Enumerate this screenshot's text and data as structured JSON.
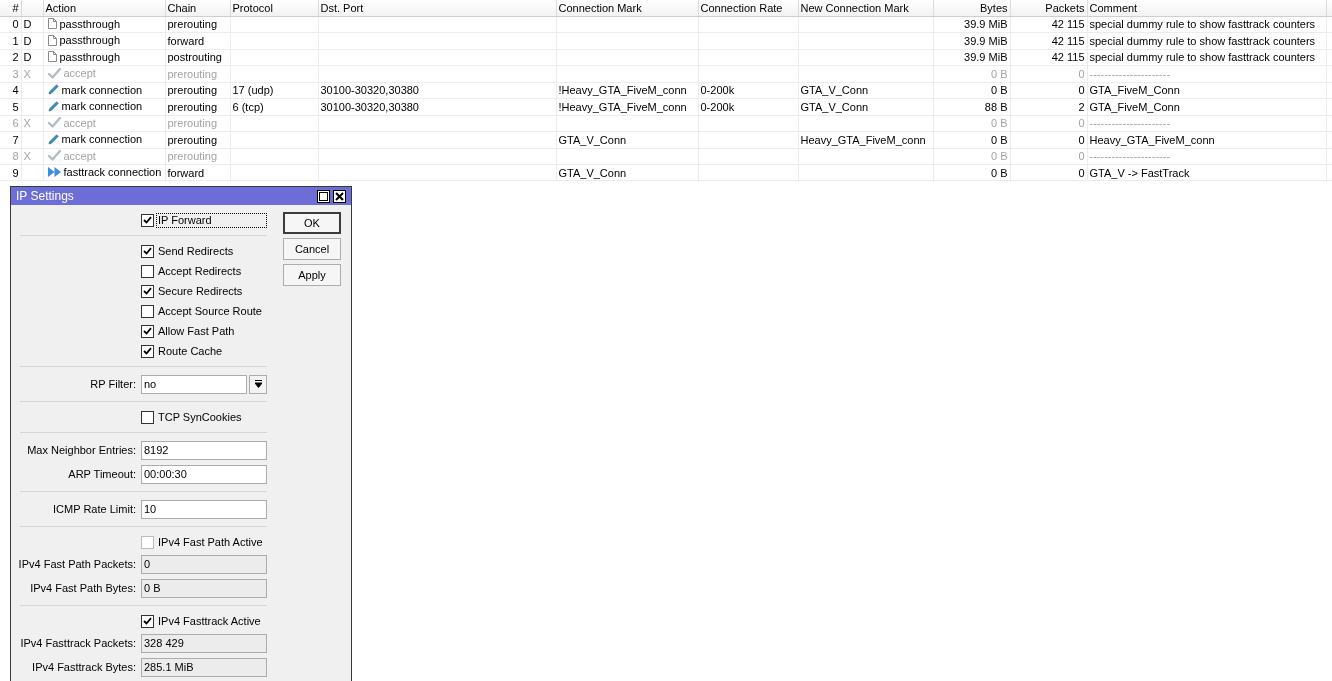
{
  "table": {
    "columns": [
      "#",
      "Action",
      "Chain",
      "Protocol",
      "Dst. Port",
      "Connection Mark",
      "Connection Rate",
      "New Connection Mark",
      "Bytes",
      "Packets",
      "Comment"
    ],
    "rows": [
      {
        "number": "0",
        "flag": "D",
        "kind": "passthrough",
        "action": "passthrough",
        "chain": "prerouting",
        "bytes": "39.9 MiB",
        "packets": "42 115",
        "comment": "special dummy rule to show fasttrack counters",
        "disabled": false
      },
      {
        "number": "1",
        "flag": "D",
        "kind": "passthrough",
        "action": "passthrough",
        "chain": "forward",
        "bytes": "39.9 MiB",
        "packets": "42 115",
        "comment": "special dummy rule to show fasttrack counters",
        "disabled": false
      },
      {
        "number": "2",
        "flag": "D",
        "kind": "passthrough",
        "action": "passthrough",
        "chain": "postrouting",
        "bytes": "39.9 MiB",
        "packets": "42 115",
        "comment": "special dummy rule to show fasttrack counters",
        "disabled": false
      },
      {
        "number": "3",
        "flag": "X",
        "kind": "accept",
        "action": "accept",
        "chain": "prerouting",
        "bytes": "0 B",
        "packets": "0",
        "comment": "----------------------",
        "disabled": true
      },
      {
        "number": "4",
        "kind": "mark",
        "action": "mark connection",
        "chain": "prerouting",
        "protocol": "17 (udp)",
        "dst_port": "30100-30320,30380",
        "connection_mark": "!Heavy_GTA_FiveM_conn",
        "connection_rate": "0-200k",
        "new_connection_mark": "GTA_V_Conn",
        "bytes": "0 B",
        "packets": "0",
        "comment": "GTA_FiveM_Conn",
        "disabled": false
      },
      {
        "number": "5",
        "kind": "mark",
        "action": "mark connection",
        "chain": "prerouting",
        "protocol": "6 (tcp)",
        "dst_port": "30100-30320,30380",
        "connection_mark": "!Heavy_GTA_FiveM_conn",
        "connection_rate": "0-200k",
        "new_connection_mark": "GTA_V_Conn",
        "bytes": "88 B",
        "packets": "2",
        "comment": "GTA_FiveM_Conn",
        "disabled": false
      },
      {
        "number": "6",
        "flag": "X",
        "kind": "accept",
        "action": "accept",
        "chain": "prerouting",
        "bytes": "0 B",
        "packets": "0",
        "comment": "----------------------",
        "disabled": true
      },
      {
        "number": "7",
        "kind": "mark",
        "action": "mark connection",
        "chain": "prerouting",
        "connection_mark": "GTA_V_Conn",
        "new_connection_mark": "Heavy_GTA_FiveM_conn",
        "bytes": "0 B",
        "packets": "0",
        "comment": "Heavy_GTA_FiveM_conn",
        "disabled": false
      },
      {
        "number": "8",
        "flag": "X",
        "kind": "accept",
        "action": "accept",
        "chain": "prerouting",
        "bytes": "0 B",
        "packets": "0",
        "comment": "----------------------",
        "disabled": true
      },
      {
        "number": "9",
        "kind": "fasttrack",
        "action": "fasttrack connection",
        "chain": "forward",
        "connection_mark": "GTA_V_Conn",
        "bytes": "0 B",
        "packets": "0",
        "comment": "GTA_V -> FastTrack",
        "disabled": false
      }
    ]
  },
  "dialog": {
    "title": "IP Settings",
    "groups": [
      {
        "items": [
          {
            "kind": "checkbox",
            "label": "IP Forward",
            "checked": true,
            "disabled": false,
            "focused": true
          }
        ]
      },
      {
        "items": [
          {
            "kind": "checkbox",
            "label": "Send Redirects",
            "checked": true,
            "disabled": false,
            "focused": false
          },
          {
            "kind": "checkbox",
            "label": "Accept Redirects",
            "checked": false,
            "disabled": false,
            "focused": false
          },
          {
            "kind": "checkbox",
            "label": "Secure Redirects",
            "checked": true,
            "disabled": false,
            "focused": false
          },
          {
            "kind": "checkbox",
            "label": "Accept Source Route",
            "checked": false,
            "disabled": false,
            "focused": false
          },
          {
            "kind": "checkbox",
            "label": "Allow Fast Path",
            "checked": true,
            "disabled": false,
            "focused": false
          },
          {
            "kind": "checkbox",
            "label": "Route Cache",
            "checked": true,
            "disabled": false,
            "focused": false
          }
        ]
      },
      {
        "items": [
          {
            "kind": "select",
            "label": "RP Filter:",
            "value": "no"
          }
        ]
      },
      {
        "items": [
          {
            "kind": "checkbox",
            "label": "TCP SynCookies",
            "checked": false,
            "disabled": false,
            "focused": false
          }
        ]
      },
      {
        "items": [
          {
            "kind": "field",
            "label": "Max Neighbor Entries:",
            "value": "8192",
            "readonly": false
          },
          {
            "kind": "field",
            "label": "ARP Timeout:",
            "value": "00:00:30",
            "readonly": false
          }
        ]
      },
      {
        "items": [
          {
            "kind": "field",
            "label": "ICMP Rate Limit:",
            "value": "10",
            "readonly": false
          }
        ]
      },
      {
        "items": [
          {
            "kind": "checkbox",
            "label": "IPv4 Fast Path Active",
            "checked": false,
            "disabled": true,
            "focused": false
          },
          {
            "kind": "field",
            "label": "IPv4 Fast Path Packets:",
            "value": "0",
            "readonly": true
          },
          {
            "kind": "field",
            "label": "IPv4 Fast Path Bytes:",
            "value": "0 B",
            "readonly": true
          }
        ]
      },
      {
        "items": [
          {
            "kind": "checkbox",
            "label": "IPv4 Fasttrack Active",
            "checked": true,
            "disabled": false,
            "focused": false
          },
          {
            "kind": "field",
            "label": "IPv4 Fasttrack Packets:",
            "value": "328 429",
            "readonly": true
          },
          {
            "kind": "field",
            "label": "IPv4 Fasttrack Bytes:",
            "value": "285.1 MiB",
            "readonly": true
          }
        ]
      }
    ],
    "buttons": [
      {
        "label": "OK",
        "default": true
      },
      {
        "label": "Cancel",
        "default": false
      },
      {
        "label": "Apply",
        "default": false
      }
    ]
  }
}
